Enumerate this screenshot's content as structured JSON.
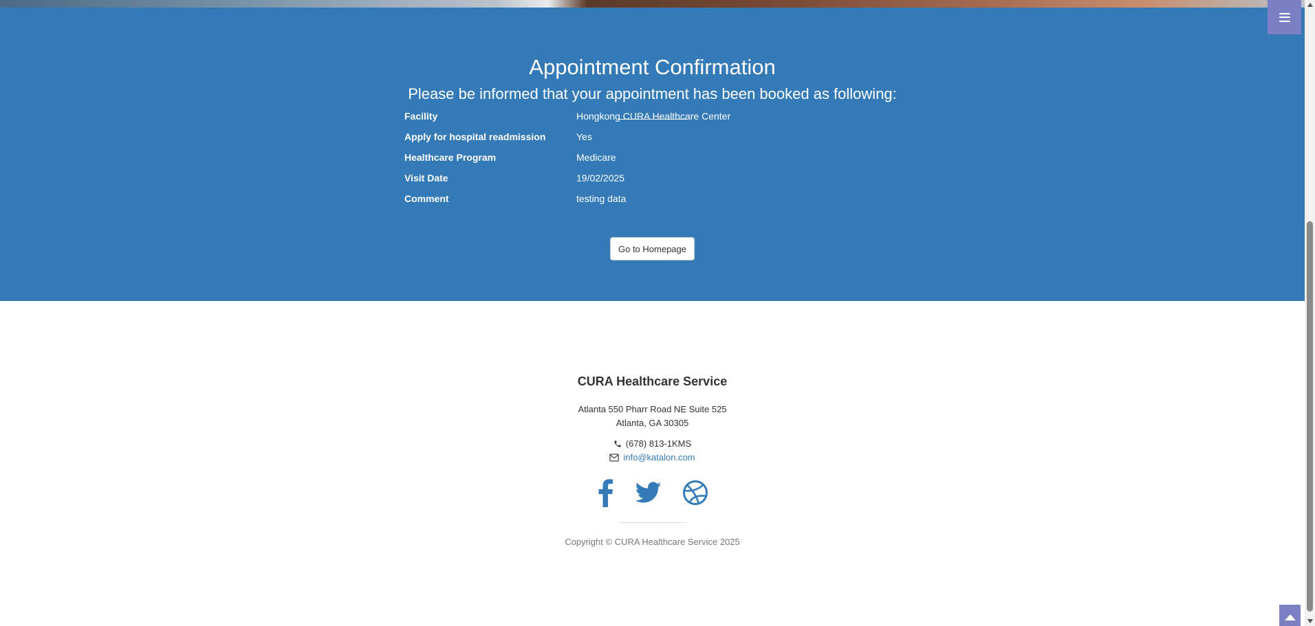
{
  "confirmation": {
    "title": "Appointment Confirmation",
    "subtitle": "Please be informed that your appointment has been booked as following:",
    "rows": [
      {
        "label": "Facility",
        "value": "Hongkong CURA Healthcare Center"
      },
      {
        "label": "Apply for hospital readmission",
        "value": "Yes"
      },
      {
        "label": "Healthcare Program",
        "value": "Medicare"
      },
      {
        "label": "Visit Date",
        "value": "19/02/2025"
      },
      {
        "label": "Comment",
        "value": "testing data"
      }
    ],
    "home_button": "Go to Homepage"
  },
  "menu": {
    "icon": "bars-icon"
  },
  "footer": {
    "brand": "CURA Healthcare Service",
    "address_line1": "Atlanta 550 Pharr Road NE Suite 525",
    "address_line2": "Atlanta, GA 30305",
    "phone": "(678) 813-1KMS",
    "email": "info@katalon.com",
    "social_icons": [
      "facebook-icon",
      "twitter-icon",
      "dribbble-icon"
    ],
    "copyright": "Copyright © CURA Healthcare Service 2025"
  },
  "colors": {
    "section_bg": "#337ab7",
    "menu_bg": "#7b7fc4",
    "link": "#337ab7"
  }
}
